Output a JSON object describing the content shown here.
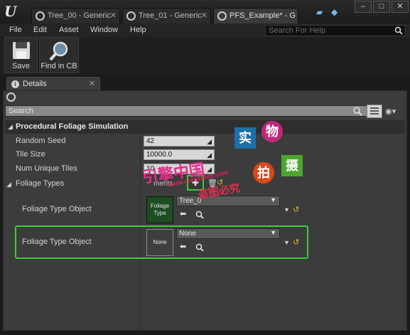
{
  "window": {
    "tabs": [
      {
        "label": "Tree_00 - Generic",
        "active": false
      },
      {
        "label": "Tree_01 - Generic",
        "active": false
      },
      {
        "label": "PFS_Example* - G",
        "active": true
      }
    ],
    "controls": [
      "minimize",
      "maximize",
      "close"
    ]
  },
  "menu": {
    "items": [
      "File",
      "Edit",
      "Asset",
      "Window",
      "Help"
    ],
    "help_search_placeholder": "Search For Help"
  },
  "toolbar": {
    "save_label": "Save",
    "find_label": "Find in CB"
  },
  "details": {
    "tab_label": "Details",
    "search_placeholder": "Search",
    "category": "Procedural Foliage Simulation",
    "properties": [
      {
        "label": "Random Seed",
        "value": "42"
      },
      {
        "label": "Tile Size",
        "value": "10000.0"
      },
      {
        "label": "Num Unique Tiles",
        "value": "10"
      }
    ],
    "foliage_types_label": "Foliage Types",
    "elements_text": "ments",
    "entries": [
      {
        "label": "Foliage Type Object",
        "thumb_text": "Foliage Type",
        "value": "Tree_0"
      },
      {
        "label": "Foliage Type Object",
        "thumb_text": "None",
        "value": "None"
      }
    ]
  },
  "watermark": {
    "chars": [
      "实",
      "物",
      "拍",
      "摄"
    ],
    "line1": "引擎中国",
    "line2": "www.unrealedx.com",
    "line3": "盗图必究"
  },
  "colors": {
    "highlight": "#39d02f",
    "panel_bg": "#3c3c3c",
    "accent_yellow": "#e0c030"
  }
}
